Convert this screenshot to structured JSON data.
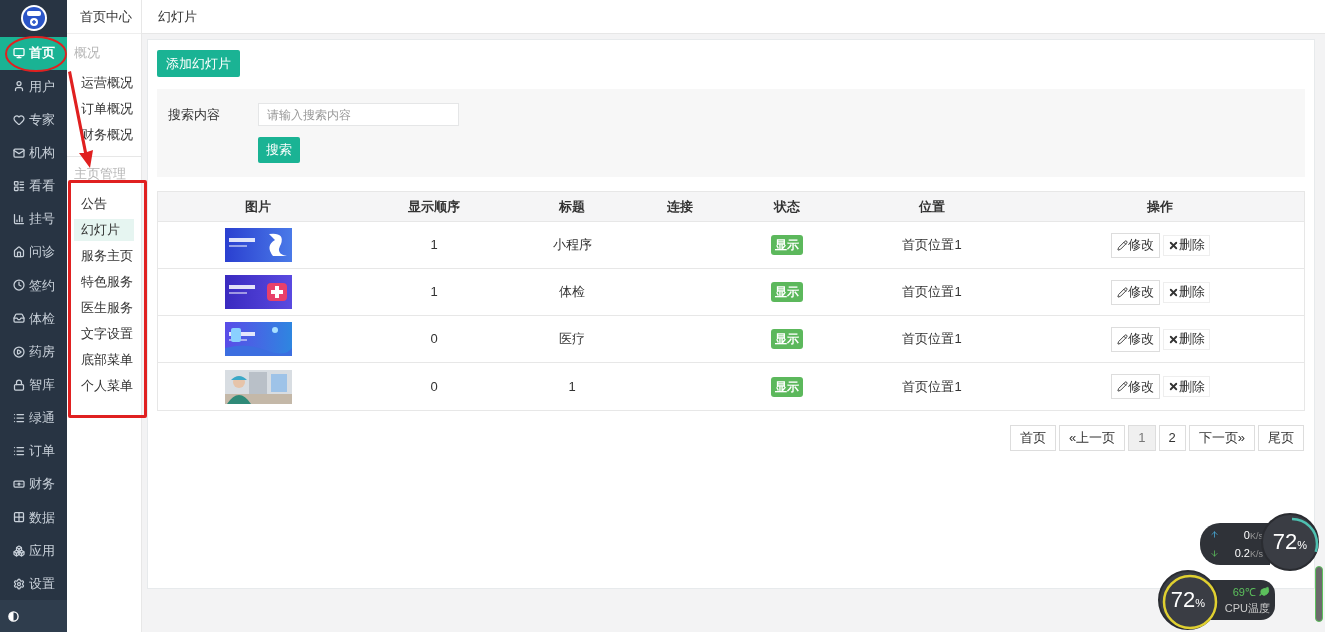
{
  "nav": [
    {
      "label": "首页",
      "selected": true
    },
    {
      "label": "用户",
      "selected": false
    },
    {
      "label": "专家",
      "selected": false
    },
    {
      "label": "机构",
      "selected": false
    },
    {
      "label": "看看",
      "selected": false
    },
    {
      "label": "挂号",
      "selected": false
    },
    {
      "label": "问诊",
      "selected": false
    },
    {
      "label": "签约",
      "selected": false
    },
    {
      "label": "体检",
      "selected": false
    },
    {
      "label": "药房",
      "selected": false
    },
    {
      "label": "智库",
      "selected": false
    },
    {
      "label": "绿通",
      "selected": false
    },
    {
      "label": "订单",
      "selected": false
    },
    {
      "label": "财务",
      "selected": false
    },
    {
      "label": "数据",
      "selected": false
    },
    {
      "label": "应用",
      "selected": false
    },
    {
      "label": "设置",
      "selected": false
    }
  ],
  "subnav": {
    "title": "首页中心",
    "groups": [
      {
        "heading": "概况",
        "items": [
          {
            "label": "运营概况",
            "selected": false
          },
          {
            "label": "订单概况",
            "selected": false
          },
          {
            "label": "财务概况",
            "selected": false
          }
        ]
      },
      {
        "heading": "主页管理",
        "items": [
          {
            "label": "公告",
            "selected": false
          },
          {
            "label": "幻灯片",
            "selected": true
          },
          {
            "label": "服务主页",
            "selected": false
          },
          {
            "label": "特色服务",
            "selected": false
          },
          {
            "label": "医生服务",
            "selected": false
          },
          {
            "label": "文字设置",
            "selected": false
          },
          {
            "label": "底部菜单",
            "selected": false
          },
          {
            "label": "个人菜单",
            "selected": false
          }
        ]
      }
    ]
  },
  "breadcrumb": "幻灯片",
  "add_button": "添加幻灯片",
  "search": {
    "label": "搜索内容",
    "placeholder": "请输入搜索内容",
    "button": "搜索"
  },
  "table": {
    "columns": [
      "图片",
      "显示顺序",
      "标题",
      "连接",
      "状态",
      "位置",
      "操作"
    ],
    "rows": [
      {
        "order": "1",
        "title": "小程序",
        "status": "显示",
        "position": "首页位置1",
        "edit": "修改",
        "delete": "删除"
      },
      {
        "order": "1",
        "title": "体检",
        "status": "显示",
        "position": "首页位置1",
        "edit": "修改",
        "delete": "删除"
      },
      {
        "order": "0",
        "title": "医疗",
        "status": "显示",
        "position": "首页位置1",
        "edit": "修改",
        "delete": "删除"
      },
      {
        "order": "0",
        "title": "1",
        "status": "显示",
        "position": "首页位置1",
        "edit": "修改",
        "delete": "删除"
      }
    ]
  },
  "pagination": [
    {
      "label": "首页",
      "selected": false
    },
    {
      "label": "«上一页",
      "selected": false
    },
    {
      "label": "1",
      "selected": true
    },
    {
      "label": "2",
      "selected": false
    },
    {
      "label": "下一页»",
      "selected": false
    },
    {
      "label": "尾页",
      "selected": false
    }
  ],
  "monitor": {
    "upload": "0",
    "upload_unit": "K/s",
    "download": "0.2",
    "download_unit": "K/s",
    "memory": {
      "value": "72",
      "unit": "%"
    },
    "cpu": {
      "value": "72",
      "unit": "%"
    },
    "temperature": "69℃",
    "temperature_label": "CPU温度"
  }
}
